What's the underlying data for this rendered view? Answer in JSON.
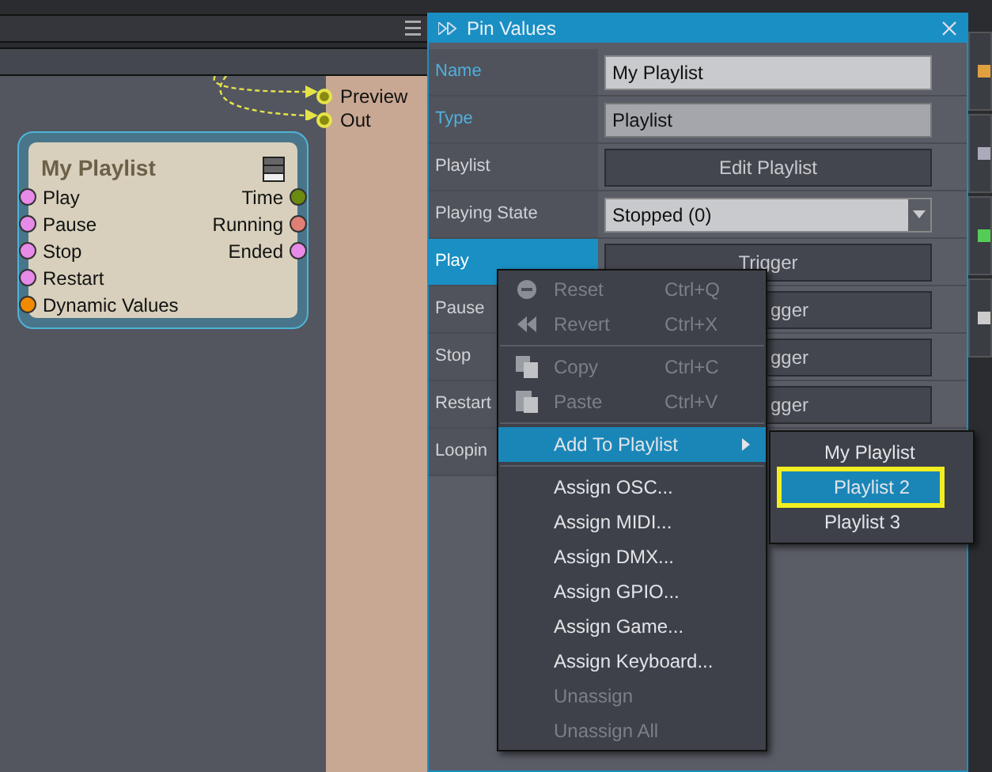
{
  "canvas": {
    "external_pins": [
      {
        "label": "Preview"
      },
      {
        "label": "Out"
      }
    ],
    "node": {
      "title": "My Playlist",
      "inputs": [
        {
          "label": "Play",
          "color": "#e88be8"
        },
        {
          "label": "Pause",
          "color": "#e88be8"
        },
        {
          "label": "Stop",
          "color": "#e88be8"
        },
        {
          "label": "Restart",
          "color": "#e88be8"
        },
        {
          "label": "Dynamic Values",
          "color": "#f08a00"
        }
      ],
      "outputs": [
        {
          "label": "Time",
          "color": "#6b8a10"
        },
        {
          "label": "Running",
          "color": "#e08075"
        },
        {
          "label": "Ended",
          "color": "#e88be8"
        }
      ]
    }
  },
  "panel": {
    "title": "Pin Values",
    "rows": [
      {
        "label": "Name",
        "kind": "field",
        "value": "My Playlist",
        "selected": false,
        "property": true
      },
      {
        "label": "Type",
        "kind": "readonly",
        "value": "Playlist",
        "selected": false,
        "property": true
      },
      {
        "label": "Playlist",
        "kind": "button",
        "value": "Edit Playlist",
        "selected": false,
        "property": false
      },
      {
        "label": "Playing State",
        "kind": "dropdown",
        "value": "Stopped (0)",
        "selected": false,
        "property": false
      },
      {
        "label": "Play",
        "kind": "button",
        "value": "Trigger",
        "selected": true,
        "property": false
      },
      {
        "label": "Pause",
        "kind": "covered",
        "value": "gger",
        "selected": false,
        "property": false
      },
      {
        "label": "Stop",
        "kind": "covered",
        "value": "gger",
        "selected": false,
        "property": false
      },
      {
        "label": "Restart",
        "kind": "covered",
        "value": "gger",
        "selected": false,
        "property": false
      },
      {
        "label": "Loopin",
        "kind": "empty",
        "selected": false,
        "property": false
      }
    ]
  },
  "context_menu": {
    "items": [
      {
        "kind": "item",
        "label": "Reset",
        "shortcut": "Ctrl+Q",
        "disabled": true,
        "selected": false
      },
      {
        "kind": "item",
        "label": "Revert",
        "shortcut": "Ctrl+X",
        "disabled": true,
        "selected": false
      },
      {
        "kind": "separator"
      },
      {
        "kind": "item",
        "label": "Copy",
        "shortcut": "Ctrl+C",
        "disabled": true,
        "selected": false
      },
      {
        "kind": "item",
        "label": "Paste",
        "shortcut": "Ctrl+V",
        "disabled": true,
        "selected": false
      },
      {
        "kind": "separator"
      },
      {
        "kind": "submenu",
        "label": "Add To Playlist",
        "disabled": false,
        "selected": true
      },
      {
        "kind": "separator"
      },
      {
        "kind": "item",
        "label": "Assign OSC...",
        "disabled": false,
        "selected": false
      },
      {
        "kind": "item",
        "label": "Assign MIDI...",
        "disabled": false,
        "selected": false
      },
      {
        "kind": "item",
        "label": "Assign DMX...",
        "disabled": false,
        "selected": false
      },
      {
        "kind": "item",
        "label": "Assign GPIO...",
        "disabled": false,
        "selected": false
      },
      {
        "kind": "item",
        "label": "Assign Game...",
        "disabled": false,
        "selected": false
      },
      {
        "kind": "item",
        "label": "Assign Keyboard...",
        "disabled": false,
        "selected": false
      },
      {
        "kind": "item",
        "label": "Unassign",
        "disabled": true,
        "selected": false
      },
      {
        "kind": "item",
        "label": "Unassign All",
        "disabled": true,
        "selected": false
      }
    ]
  },
  "submenu": {
    "items": [
      {
        "label": "My Playlist",
        "selected": false
      },
      {
        "label": "Playlist 2",
        "selected": true
      },
      {
        "label": "Playlist 3",
        "selected": false
      }
    ]
  }
}
